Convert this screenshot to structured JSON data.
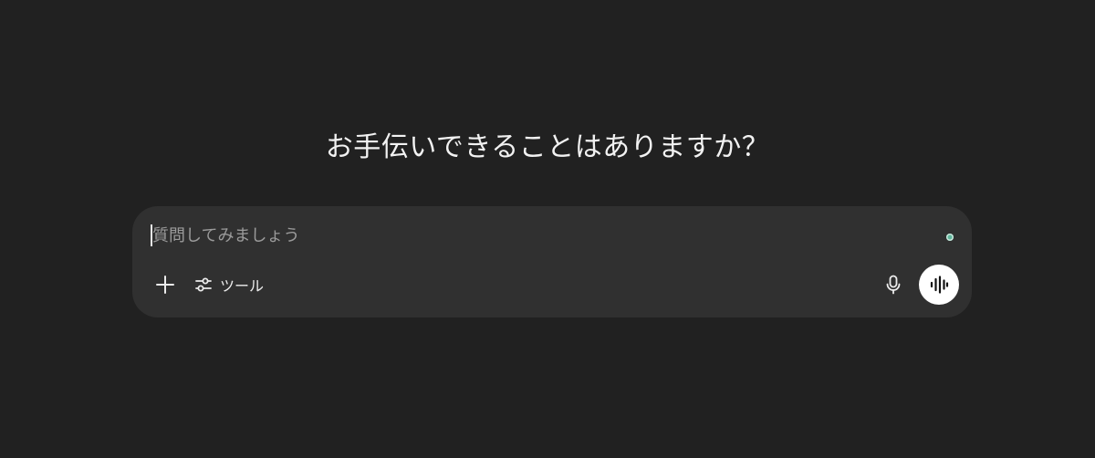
{
  "headline": "お手伝いできることはありますか？",
  "composer": {
    "placeholder": "質問してみましょう",
    "value": "",
    "status_color": "#5fb59b"
  },
  "toolbar": {
    "add_icon": "plus-icon",
    "tools_icon": "sliders-icon",
    "tools_label": "ツール",
    "mic_icon": "microphone-icon",
    "voice_icon": "voice-waveform-icon"
  },
  "colors": {
    "background": "#212121",
    "composer_bg": "#303030",
    "text": "#ececec",
    "placeholder": "#9b9b9b",
    "voice_button_bg": "#ffffff"
  }
}
